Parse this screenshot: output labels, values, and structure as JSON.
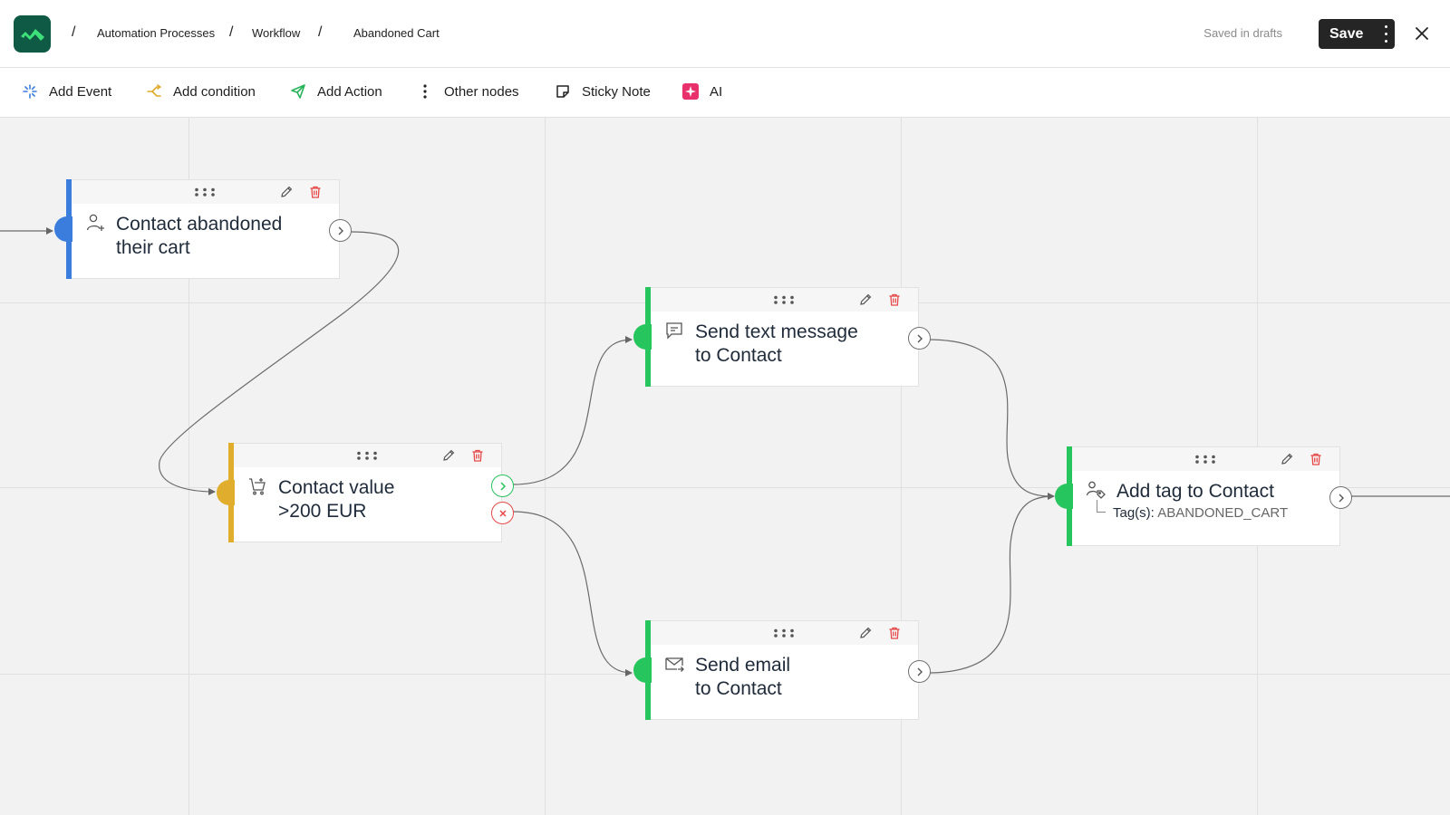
{
  "header": {
    "breadcrumbs": [
      "Automation Processes",
      "Workflow",
      "Abandoned Cart"
    ],
    "saved_status": "Saved in drafts",
    "save_label": "Save"
  },
  "toolbar": {
    "items": [
      {
        "label": "Add Event",
        "icon": "sparkle-icon",
        "color": "#3b7ddd"
      },
      {
        "label": "Add condition",
        "icon": "split-icon",
        "color": "#e0a92a"
      },
      {
        "label": "Add Action",
        "icon": "send-icon",
        "color": "#26b35a"
      },
      {
        "label": "Other nodes",
        "icon": "more-vertical-icon",
        "color": "#222222"
      },
      {
        "label": "Sticky Note",
        "icon": "sticky-note-icon",
        "color": "#222222"
      },
      {
        "label": "AI",
        "icon": "ai-sparkle-icon",
        "color": "#e8306c"
      }
    ]
  },
  "nodes": [
    {
      "id": "event",
      "kind": "event",
      "title_line1": "Contact abandoned",
      "title_line2": "their cart",
      "icon": "user-plus-icon",
      "color": "#3b7ddd"
    },
    {
      "id": "condition",
      "kind": "condition",
      "title_line1": "Contact value",
      "title_line2": ">200 EUR",
      "icon": "cart-icon",
      "color": "#e0ad2c"
    },
    {
      "id": "sms",
      "kind": "action",
      "title_line1": "Send text message",
      "title_line2": "to Contact",
      "icon": "chat-icon",
      "color": "#26c55d"
    },
    {
      "id": "email",
      "kind": "action",
      "title_line1": "Send email",
      "title_line2": "to Contact",
      "icon": "mail-icon",
      "color": "#26c55d"
    },
    {
      "id": "tag",
      "kind": "action",
      "title_line1": "Add tag to Contact",
      "sub_label": "Tag(s):",
      "sub_value": "ABANDONED_CART",
      "icon": "user-tag-icon",
      "color": "#26c55d"
    }
  ],
  "colors": {
    "brand": "#0f5a45",
    "brand_accent": "#3ee07a",
    "danger": "#e54848",
    "success": "#27c25d"
  }
}
